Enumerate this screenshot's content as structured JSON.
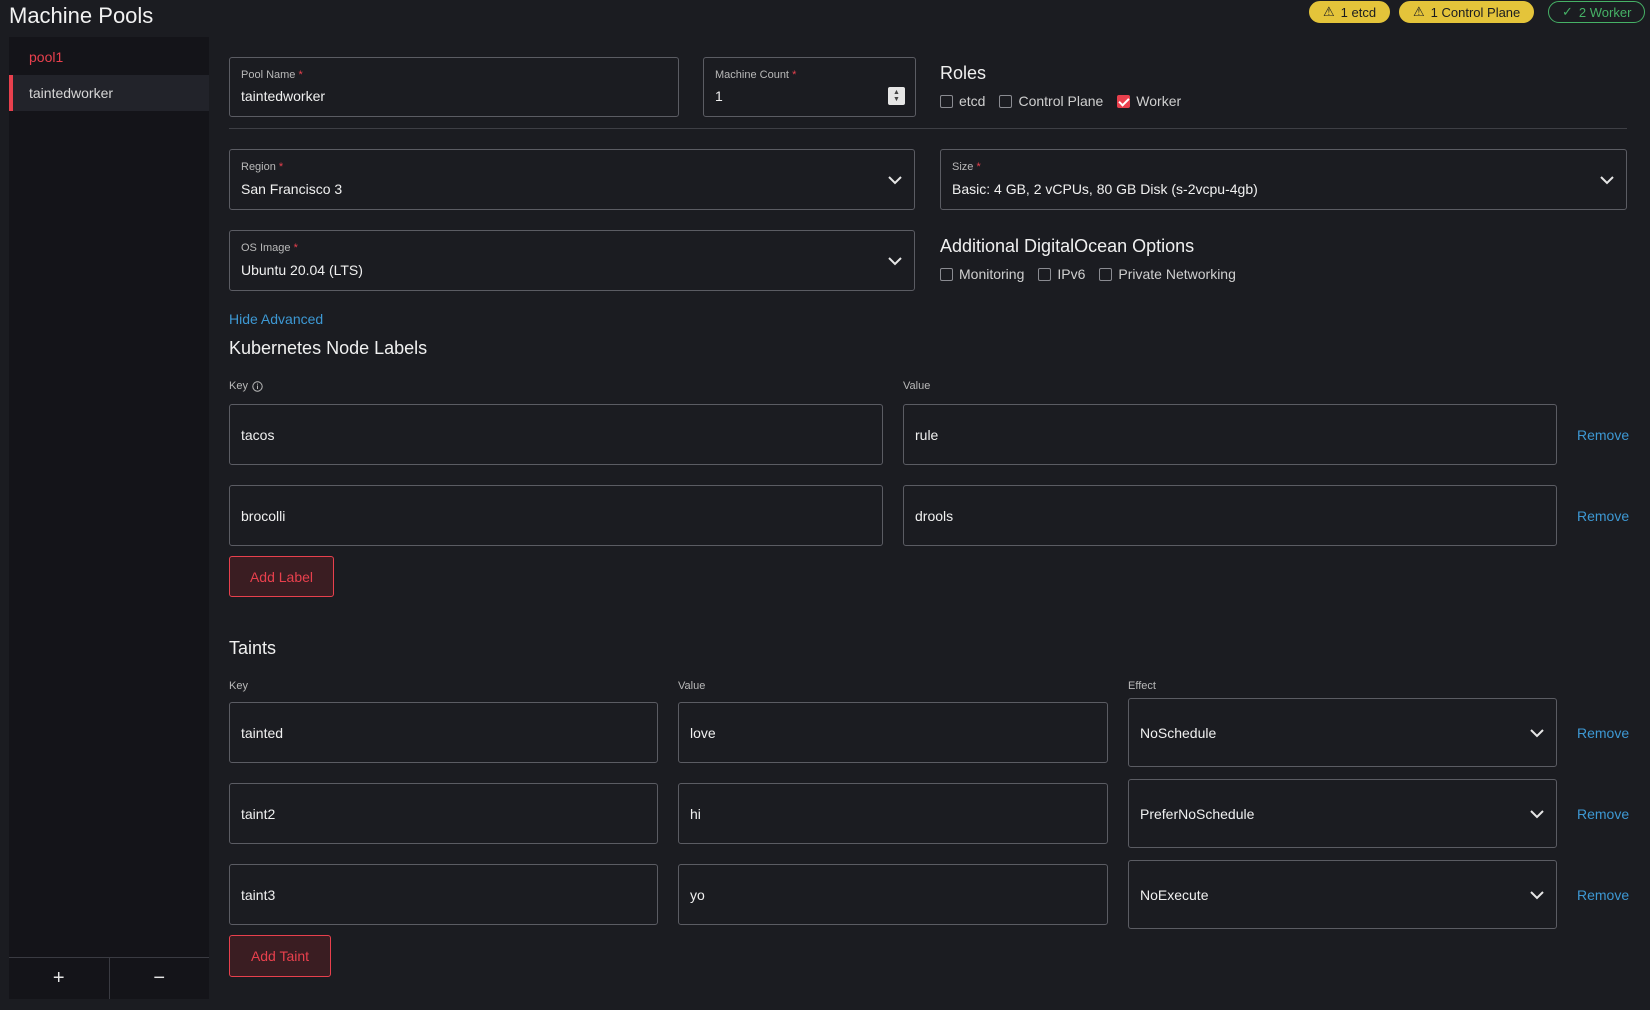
{
  "page": {
    "title": "Machine Pools"
  },
  "badges": [
    {
      "icon": "warning-icon",
      "label": "1 etcd"
    },
    {
      "icon": "warning-icon",
      "label": "1 Control Plane"
    },
    {
      "icon": "check-icon",
      "label": "2 Worker"
    }
  ],
  "sidebar": {
    "items": [
      {
        "label": "pool1"
      },
      {
        "label": "taintedworker"
      }
    ],
    "add_label": "+",
    "remove_label": "−"
  },
  "form": {
    "pool_name": {
      "label": "Pool Name",
      "value": "taintedworker"
    },
    "machine_count": {
      "label": "Machine Count",
      "value": "1"
    },
    "roles": {
      "title": "Roles",
      "options": [
        {
          "label": "etcd",
          "checked": false
        },
        {
          "label": "Control Plane",
          "checked": false
        },
        {
          "label": "Worker",
          "checked": true
        }
      ]
    },
    "region": {
      "label": "Region",
      "value": "San Francisco 3"
    },
    "size": {
      "label": "Size",
      "value": "Basic: 4 GB, 2 vCPUs, 80 GB Disk (s-2vcpu-4gb)"
    },
    "os_image": {
      "label": "OS Image",
      "value": "Ubuntu 20.04 (LTS)"
    },
    "do_options": {
      "title": "Additional DigitalOcean Options",
      "options": [
        {
          "label": "Monitoring",
          "checked": false
        },
        {
          "label": "IPv6",
          "checked": false
        },
        {
          "label": "Private Networking",
          "checked": false
        }
      ]
    },
    "required_mark": "*"
  },
  "advanced": {
    "toggle_label": "Hide Advanced",
    "labels": {
      "title": "Kubernetes Node Labels",
      "key_header": "Key",
      "value_header": "Value",
      "rows": [
        {
          "key": "tacos",
          "value": "rule"
        },
        {
          "key": "brocolli",
          "value": "drools"
        }
      ],
      "remove_label": "Remove",
      "add_label": "Add Label"
    },
    "taints": {
      "title": "Taints",
      "key_header": "Key",
      "value_header": "Value",
      "effect_header": "Effect",
      "rows": [
        {
          "key": "tainted",
          "value": "love",
          "effect": "NoSchedule"
        },
        {
          "key": "taint2",
          "value": "hi",
          "effect": "PreferNoSchedule"
        },
        {
          "key": "taint3",
          "value": "yo",
          "effect": "NoExecute"
        }
      ],
      "remove_label": "Remove",
      "add_label": "Add Taint"
    }
  },
  "colors": {
    "accent": "#e8404d",
    "link": "#3d98d3",
    "warning": "#e4c43a",
    "success": "#46b166",
    "background": "#1b1c21"
  }
}
